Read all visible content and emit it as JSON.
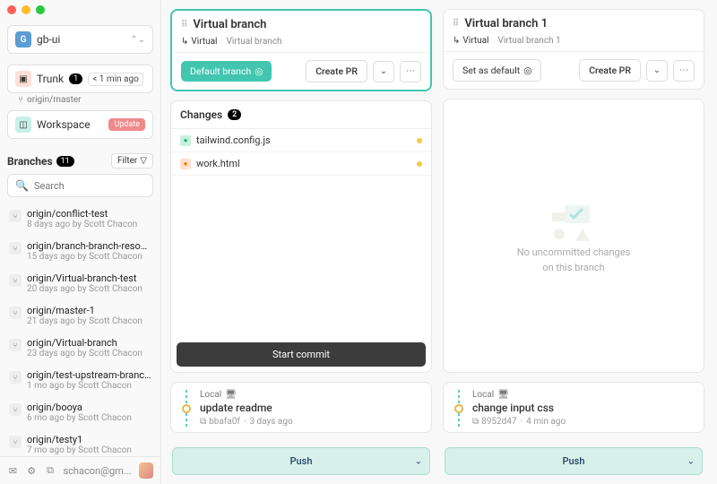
{
  "window": {
    "traffic": true
  },
  "sidebar": {
    "repo": {
      "logo": "G",
      "name": "gb-ui"
    },
    "trunk": {
      "label": "Trunk",
      "count": "1",
      "age": "< 1 min ago"
    },
    "origin_line": "origin/master",
    "workspace": {
      "label": "Workspace",
      "update": "Update"
    },
    "branches_header": "Branches",
    "branches_count": "11",
    "filter_label": "Filter",
    "search_placeholder": "Search",
    "branches": [
      {
        "name": "origin/conflict-test",
        "meta": "8 days ago by Scott Chacon"
      },
      {
        "name": "origin/branch-branch-resource...",
        "meta": "15 days ago by Scott Chacon"
      },
      {
        "name": "origin/Virtual-branch-test",
        "meta": "20 days ago by Scott Chacon"
      },
      {
        "name": "origin/master-1",
        "meta": "21 days ago by Scott Chacon"
      },
      {
        "name": "origin/Virtual-branch",
        "meta": "23 days ago by Scott Chacon"
      },
      {
        "name": "origin/test-upstream-branch2",
        "meta": "1 mo ago by Scott Chacon"
      },
      {
        "name": "origin/booya",
        "meta": "6 mo ago by Scott Chacon"
      },
      {
        "name": "origin/testy1",
        "meta": "7 mo ago by Scott Chacon"
      }
    ],
    "footer": {
      "email": "schacon@gm..."
    }
  },
  "columns": [
    {
      "title": "Virtual branch",
      "tab_active": "Virtual",
      "tab_inactive": "Virtual branch",
      "is_default": true,
      "default_label": "Default branch",
      "set_default_label": "Set as default",
      "create_pr": "Create PR",
      "changes_label": "Changes",
      "changes_count": "2",
      "files": [
        {
          "icon": "green",
          "name": "tailwind.config.js"
        },
        {
          "icon": "orange",
          "name": "work.html"
        }
      ],
      "empty_msg1": "",
      "empty_msg2": "",
      "start_commit": "Start commit",
      "commit": {
        "local": "Local",
        "msg": "update readme",
        "sha": "bbafa0f",
        "age": "3 days ago"
      },
      "push": "Push"
    },
    {
      "title": "Virtual branch 1",
      "tab_active": "Virtual",
      "tab_inactive": "Virtual branch 1",
      "is_default": false,
      "default_label": "Default branch",
      "set_default_label": "Set as default",
      "create_pr": "Create PR",
      "changes_label": "",
      "changes_count": "",
      "files": [],
      "empty_msg1": "No uncommitted changes",
      "empty_msg2": "on this branch",
      "start_commit": "",
      "commit": {
        "local": "Local",
        "msg": "change input css",
        "sha": "8952d47",
        "age": "4 min ago"
      },
      "push": "Push"
    }
  ]
}
